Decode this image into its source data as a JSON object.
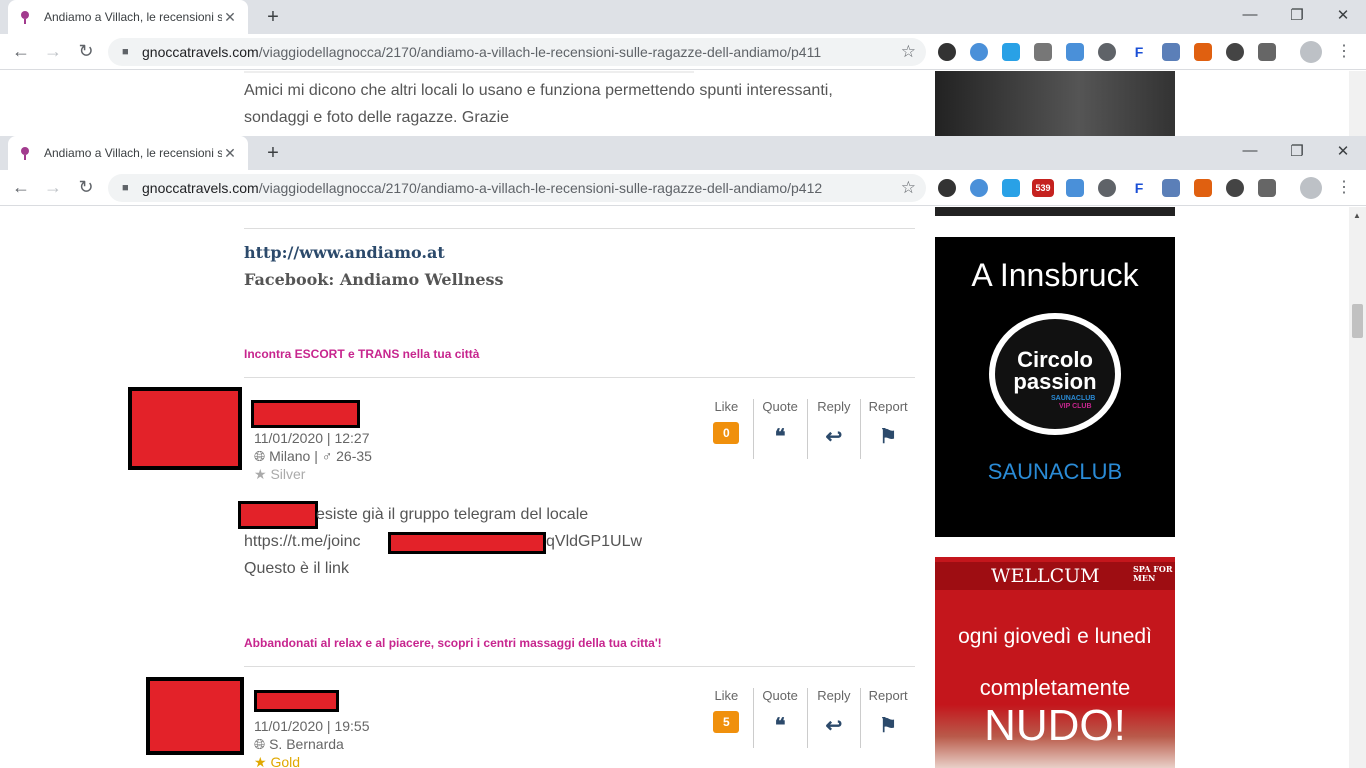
{
  "window1": {
    "tab_title": "Andiamo a Villach, le recensioni s",
    "url_host": "gnoccatravels.com",
    "url_path": "/viaggiodellagnocca/2170/andiamo-a-villach-le-recensioni-sulle-ragazze-dell-andiamo/p411",
    "text_line1": "Amici mi dicono che altri locali lo usano e funziona permettendo spunti interessanti,",
    "text_line2": "sondaggi e foto delle ragazze. Grazie"
  },
  "window2": {
    "tab_title": "Andiamo a Villach, le recensioni s",
    "url_host": "gnoccatravels.com",
    "url_path": "/viaggiodellagnocca/2170/andiamo-a-villach-le-recensioni-sulle-ragazze-dell-andiamo/p412",
    "mail_badge": "539"
  },
  "icons": {
    "new_tab": "+",
    "close_tab": "✕",
    "minimize": "—",
    "restore": "❐",
    "close_window": "✕",
    "back": "←",
    "forward": "→",
    "reload": "↻",
    "star": "☆",
    "kebab": "⋮",
    "lock": "🔒"
  },
  "body": {
    "website_link": "http://www.andiamo.at",
    "facebook": "Facebook: Andiamo Wellness",
    "promo1": "Incontra ESCORT e TRANS nella tua città",
    "promo2": "Abbandonati al relax e al piacere, scopri i centri massaggi della tua citta'!"
  },
  "actions": {
    "like": "Like",
    "quote": "Quote",
    "reply": "Reply",
    "report": "Report"
  },
  "posts": [
    {
      "date": "11/01/2020 | 12:27",
      "location": "Milano | ♂ 26-35",
      "rank": "Silver",
      "likes": "0",
      "line1": "esiste già il gruppo telegram del locale",
      "link_prefix": "https://t.me/joinc",
      "link_suffix": "qVldGP1ULw",
      "line3": "Questo è il link"
    },
    {
      "date": "11/01/2020 | 19:55",
      "location": "S. Bernarda",
      "rank": "Gold",
      "likes": "5"
    }
  ],
  "ads": {
    "innsbruck": {
      "title": "A Innsbruck",
      "logo_line1": "Circolo",
      "logo_line2": "passion",
      "logo_sub1": "SAUNACLUB",
      "logo_sub2": "VIP CLUB",
      "bottom": "SAUNACLUB"
    },
    "wellcum": {
      "brand": "WELLCUM",
      "tag": "SPA FOR MEN",
      "line1": "ogni giovedì e lunedì",
      "line2": "completamente",
      "line3": "NUDO!"
    }
  }
}
